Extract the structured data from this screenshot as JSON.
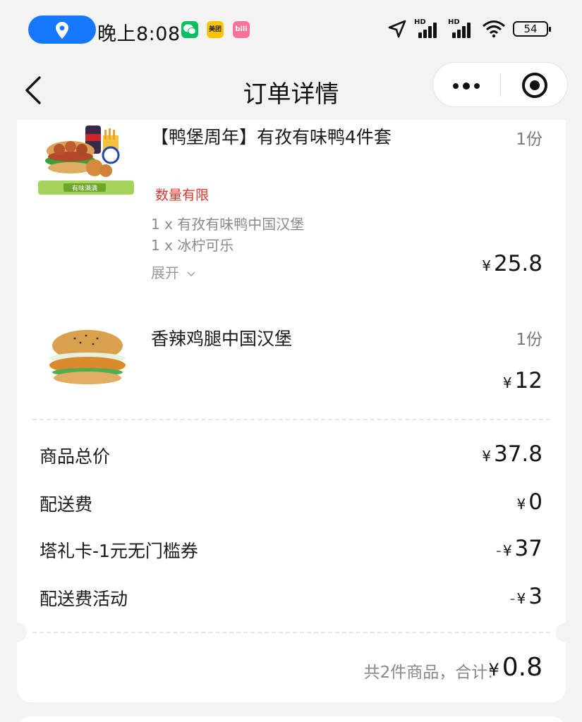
{
  "status_bar": {
    "time": "晚上8:08",
    "apps": [
      "wechat-icon",
      "meituan-icon",
      "bilibili-icon"
    ],
    "meituan_label": "美团",
    "bili_label": "bili",
    "hd1": "HD",
    "hd2": "HD",
    "battery": "54",
    "location_pill_color": "#1677ff"
  },
  "nav": {
    "title": "订单详情"
  },
  "items": [
    {
      "name": "【鸭堡周年】有孜有味鸭4件套",
      "qty": "1份",
      "tag": "数量有限",
      "components": [
        "1 x 有孜有味鸭中国汉堡",
        "1 x 冰柠可乐"
      ],
      "expand_label": "展开",
      "currency": "¥",
      "price": "25.8",
      "image_badge": "有味满满"
    },
    {
      "name": "香辣鸡腿中国汉堡",
      "qty": "1份",
      "currency": "¥",
      "price": "12"
    }
  ],
  "summary": [
    {
      "label": "商品总价",
      "sign": "",
      "currency": "¥",
      "value": "37.8"
    },
    {
      "label": "配送费",
      "sign": "",
      "currency": "¥",
      "value": "0"
    },
    {
      "label": "塔礼卡-1元无门槛券",
      "sign": "-",
      "currency": "¥",
      "value": "37"
    },
    {
      "label": "配送费活动",
      "sign": "-",
      "currency": "¥",
      "value": "3"
    }
  ],
  "total": {
    "label": "共2件商品，合计:",
    "currency": "¥",
    "value": "0.8"
  },
  "colors": {
    "accent_red": "#e0352b",
    "background": "#f3f3f3",
    "card": "#ffffff"
  }
}
